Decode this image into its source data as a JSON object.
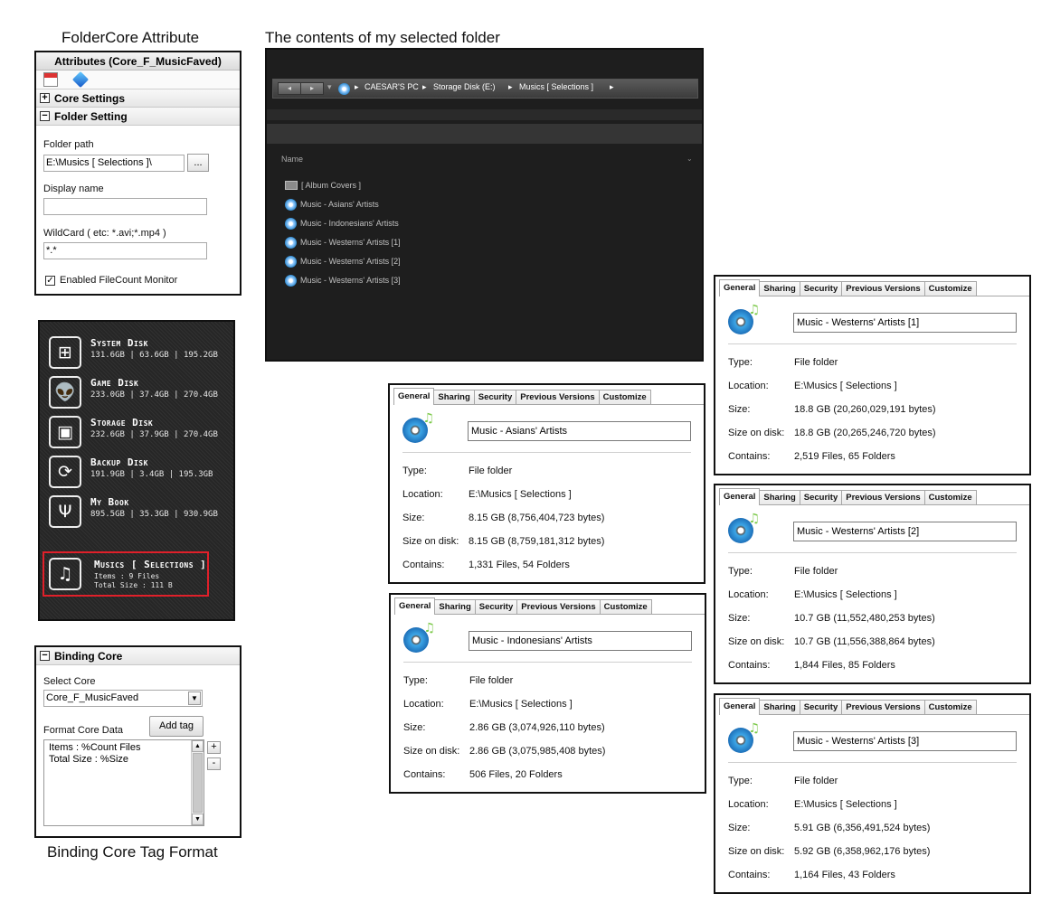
{
  "captions": {
    "folder_core": "FolderCore Attribute",
    "contents": "The contents of my selected folder",
    "binding_format": "Binding Core Tag Format"
  },
  "attributes": {
    "title": "Attributes (Core_F_MusicFaved)",
    "core_settings": "Core Settings",
    "folder_setting": "Folder Setting",
    "folder_path_label": "Folder path",
    "folder_path_value": "E:\\Musics [ Selections ]\\",
    "browse_label": "...",
    "display_name_label": "Display name",
    "display_name_value": "",
    "wildcard_label": "WildCard ( etc: *.avi;*.mp4 )",
    "wildcard_value": "*.*",
    "enable_label": "Enabled FileCount Monitor",
    "enable_checked": true
  },
  "disks": [
    {
      "name": "System Disk",
      "stats": "131.6GB | 63.6GB | 195.2GB",
      "icon": "windows-icon"
    },
    {
      "name": "Game Disk",
      "stats": "233.0GB | 37.4GB | 270.4GB",
      "icon": "alien-icon"
    },
    {
      "name": "Storage Disk",
      "stats": "232.6GB | 37.9GB | 270.4GB",
      "icon": "briefcase-icon"
    },
    {
      "name": "Backup Disk",
      "stats": "191.9GB | 3.4GB | 195.3GB",
      "icon": "refresh-icon"
    },
    {
      "name": "My Book",
      "stats": "895.5GB | 35.3GB | 930.9GB",
      "icon": "usb-icon"
    }
  ],
  "selected_disk": {
    "name": "Musics [ Selections ]",
    "line1": "Items : 9 Files",
    "line2": "Total Size : 111 B",
    "icon": "music-note-icon"
  },
  "binding": {
    "title": "Binding Core",
    "select_core_label": "Select Core",
    "select_core_value": "Core_F_MusicFaved",
    "format_label": "Format Core Data",
    "add_tag": "Add tag",
    "format_line1": "Items : %Count Files",
    "format_line2": "Total Size : %Size",
    "plus": "+",
    "minus": "-"
  },
  "explorer": {
    "breadcrumb": [
      "CAESAR'S PC",
      "Storage Disk (E:)",
      "Musics [ Selections ]"
    ],
    "column_name": "Name",
    "items": [
      "[ Album Covers ]",
      "Music - Asians' Artists",
      "Music - Indonesians' Artists",
      "Music - Westerns' Artists [1]",
      "Music - Westerns' Artists [2]",
      "Music - Westerns' Artists [3]"
    ]
  },
  "tabs": [
    "General",
    "Sharing",
    "Security",
    "Previous Versions",
    "Customize"
  ],
  "labels": {
    "type": "Type:",
    "location": "Location:",
    "size": "Size:",
    "size_on_disk": "Size on disk:",
    "contains": "Contains:"
  },
  "properties": [
    {
      "name": "Music - Asians' Artists",
      "type": "File folder",
      "location": "E:\\Musics [ Selections ]",
      "size": "8.15 GB (8,756,404,723 bytes)",
      "size_on_disk": "8.15 GB (8,759,181,312 bytes)",
      "contains": "1,331 Files, 54 Folders"
    },
    {
      "name": "Music - Indonesians' Artists",
      "type": "File folder",
      "location": "E:\\Musics [ Selections ]",
      "size": "2.86 GB (3,074,926,110 bytes)",
      "size_on_disk": "2.86 GB (3,075,985,408 bytes)",
      "contains": "506 Files, 20 Folders"
    },
    {
      "name": "Music - Westerns' Artists [1]",
      "type": "File folder",
      "location": "E:\\Musics [ Selections ]",
      "size": "18.8 GB (20,260,029,191 bytes)",
      "size_on_disk": "18.8 GB (20,265,246,720 bytes)",
      "contains": "2,519 Files, 65 Folders"
    },
    {
      "name": "Music - Westerns' Artists [2]",
      "type": "File folder",
      "location": "E:\\Musics [ Selections ]",
      "size": "10.7 GB (11,552,480,253 bytes)",
      "size_on_disk": "10.7 GB (11,556,388,864 bytes)",
      "contains": "1,844 Files, 85 Folders"
    },
    {
      "name": "Music - Westerns' Artists [3]",
      "type": "File folder",
      "location": "E:\\Musics [ Selections ]",
      "size": "5.91 GB (6,356,491,524 bytes)",
      "size_on_disk": "5.92 GB (6,358,962,176 bytes)",
      "contains": "1,164 Files, 43 Folders"
    }
  ]
}
